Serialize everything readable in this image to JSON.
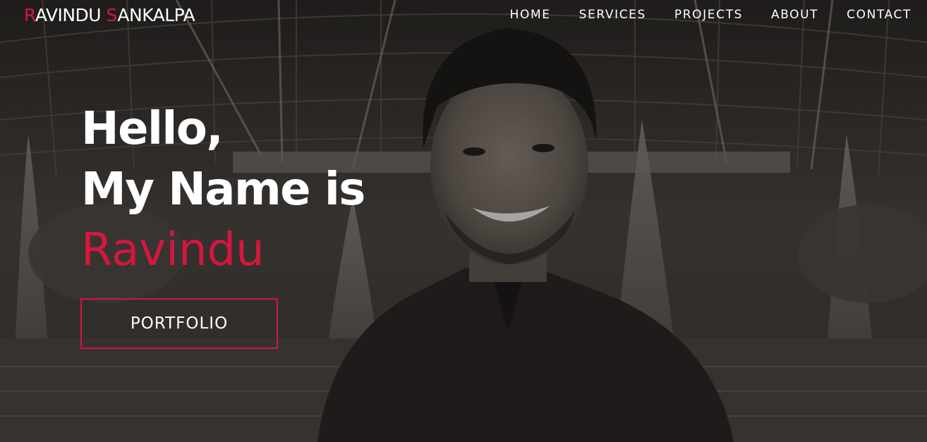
{
  "brand": {
    "first_initial": "R",
    "first_rest": "AVINDU",
    "last_initial": "S",
    "last_rest": "ANKALPA",
    "accent_color": "#d3173d"
  },
  "nav": {
    "items": [
      {
        "label": "HOME"
      },
      {
        "label": "SERVICES"
      },
      {
        "label": "PROJECTS"
      },
      {
        "label": "ABOUT"
      },
      {
        "label": "CONTACT"
      }
    ]
  },
  "hero": {
    "greeting": "Hello,",
    "intro": "My Name is",
    "name": "Ravindu",
    "cta_label": "PORTFOLIO",
    "background": "portrait-photo"
  }
}
